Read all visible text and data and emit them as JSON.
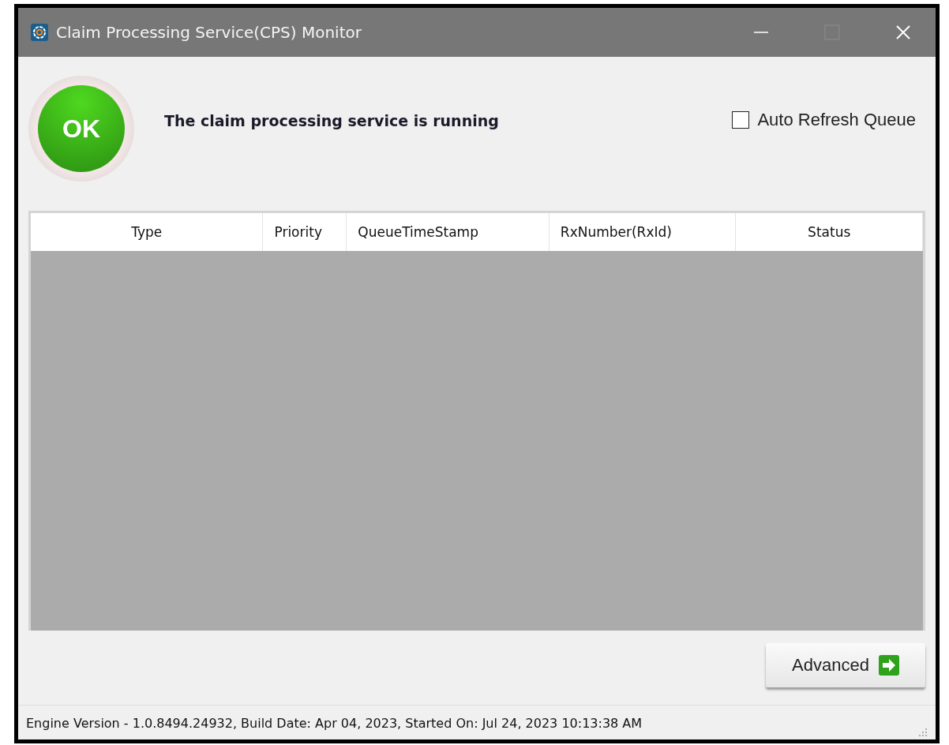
{
  "window": {
    "title": "Claim Processing Service(CPS) Monitor"
  },
  "status": {
    "kind": "ok",
    "badge": "OK",
    "message": "The claim processing service is running"
  },
  "auto_refresh": {
    "label": "Auto Refresh Queue",
    "checked": false
  },
  "table": {
    "columns": [
      {
        "label": "Type"
      },
      {
        "label": "Priority"
      },
      {
        "label": "QueueTimeStamp"
      },
      {
        "label": "RxNumber(RxId)"
      },
      {
        "label": "Status"
      }
    ]
  },
  "advanced_button": {
    "label": "Advanced"
  },
  "status_bar": {
    "text": "Engine Version - 1.0.8494.24932, Build Date: Apr 04, 2023, Started On: Jul 24, 2023 10:13:38 AM"
  }
}
